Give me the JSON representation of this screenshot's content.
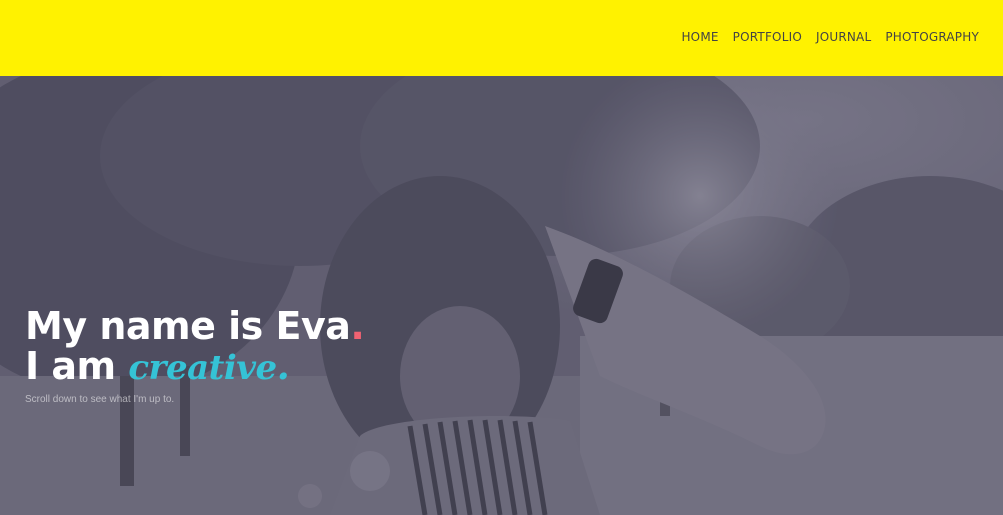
{
  "nav": {
    "items": [
      "HOME",
      "PORTFOLIO",
      "JOURNAL",
      "PHOTOGRAPHY"
    ]
  },
  "hero": {
    "line1": "My name is Eva",
    "line1_dot": ".",
    "line2_prefix": "I am ",
    "line2_accent": "creative",
    "line2_dot": ".",
    "subtitle": "Scroll down to see what I'm up to."
  },
  "colors": {
    "header_bg": "#fff200",
    "accent_red": "#f06272",
    "accent_cyan": "#35c3d6",
    "overlay": "#5f5d6f"
  }
}
